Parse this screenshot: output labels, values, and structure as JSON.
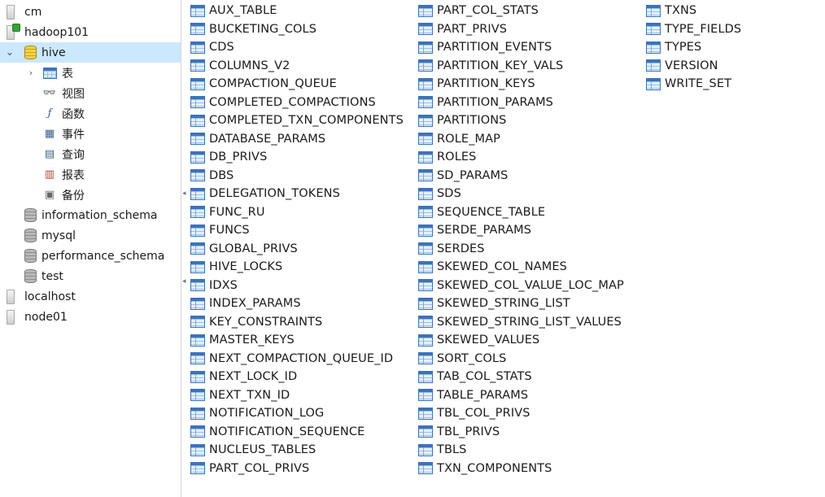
{
  "navigator": {
    "connections": [
      {
        "name": "cm",
        "icon": "server-icon"
      },
      {
        "name": "hadoop101",
        "icon": "server-connected-icon"
      },
      {
        "name": "localhost",
        "icon": "server-icon"
      },
      {
        "name": "node01",
        "icon": "server-icon"
      }
    ],
    "databases": [
      "hive",
      "information_schema",
      "mysql",
      "performance_schema",
      "test"
    ],
    "hive_categories": [
      "表",
      "视图",
      "函数",
      "事件",
      "查询",
      "报表",
      "备份"
    ],
    "expand_collapsed": "›",
    "expand_open": "⌄"
  },
  "tables": {
    "column1": [
      "AUX_TABLE",
      "BUCKETING_COLS",
      "CDS",
      "COLUMNS_V2",
      "COMPACTION_QUEUE",
      "COMPLETED_COMPACTIONS",
      "COMPLETED_TXN_COMPONENTS",
      "DATABASE_PARAMS",
      "DB_PRIVS",
      "DBS",
      "DELEGATION_TOKENS",
      "FUNC_RU",
      "FUNCS",
      "GLOBAL_PRIVS",
      "HIVE_LOCKS",
      "IDXS",
      "INDEX_PARAMS",
      "KEY_CONSTRAINTS",
      "MASTER_KEYS",
      "NEXT_COMPACTION_QUEUE_ID",
      "NEXT_LOCK_ID",
      "NEXT_TXN_ID",
      "NOTIFICATION_LOG",
      "NOTIFICATION_SEQUENCE",
      "NUCLEUS_TABLES",
      "PART_COL_PRIVS"
    ],
    "column2": [
      "PART_COL_STATS",
      "PART_PRIVS",
      "PARTITION_EVENTS",
      "PARTITION_KEY_VALS",
      "PARTITION_KEYS",
      "PARTITION_PARAMS",
      "PARTITIONS",
      "ROLE_MAP",
      "ROLES",
      "SD_PARAMS",
      "SDS",
      "SEQUENCE_TABLE",
      "SERDE_PARAMS",
      "SERDES",
      "SKEWED_COL_NAMES",
      "SKEWED_COL_VALUE_LOC_MAP",
      "SKEWED_STRING_LIST",
      "SKEWED_STRING_LIST_VALUES",
      "SKEWED_VALUES",
      "SORT_COLS",
      "TAB_COL_STATS",
      "TABLE_PARAMS",
      "TBL_COL_PRIVS",
      "TBL_PRIVS",
      "TBLS",
      "TXN_COMPONENTS"
    ],
    "column3": [
      "TXNS",
      "TYPE_FIELDS",
      "TYPES",
      "VERSION",
      "WRITE_SET"
    ]
  }
}
